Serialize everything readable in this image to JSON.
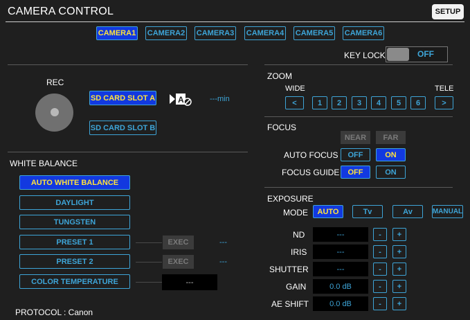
{
  "header": {
    "title": "CAMERA CONTROL",
    "setup_label": "SETUP"
  },
  "cameras": [
    "CAMERA1",
    "CAMERA2",
    "CAMERA3",
    "CAMERA4",
    "CAMERA5",
    "CAMERA6"
  ],
  "key_lock": {
    "label": "KEY LOCK",
    "state": "OFF"
  },
  "rec": {
    "label": "REC",
    "slot_a": "SD CARD SLOT A",
    "slot_b": "SD CARD SLOT B",
    "remaining": "---min"
  },
  "white_balance": {
    "title": "WHITE BALANCE",
    "auto": "AUTO WHITE BALANCE",
    "daylight": "DAYLIGHT",
    "tungsten": "TUNGSTEN",
    "preset1": "PRESET 1",
    "preset2": "PRESET 2",
    "color_temp": "COLOR TEMPERATURE",
    "exec": "EXEC",
    "preset1_value": "---",
    "preset2_value": "---",
    "color_temp_value": "---"
  },
  "protocol": "PROTOCOL : Canon",
  "zoom": {
    "title": "ZOOM",
    "wide": "WIDE",
    "tele": "TELE",
    "left": "<",
    "right": ">",
    "steps": [
      "1",
      "2",
      "3",
      "4",
      "5",
      "6"
    ]
  },
  "focus": {
    "title": "FOCUS",
    "near": "NEAR",
    "far": "FAR",
    "auto_focus_label": "AUTO FOCUS",
    "focus_guide_label": "FOCUS GUIDE",
    "off": "OFF",
    "on": "ON"
  },
  "exposure": {
    "title": "EXPOSURE",
    "mode_label": "MODE",
    "modes": [
      "AUTO",
      "Tv",
      "Av",
      "MANUAL"
    ],
    "nd_label": "ND",
    "iris_label": "IRIS",
    "shutter_label": "SHUTTER",
    "gain_label": "GAIN",
    "ae_shift_label": "AE SHIFT",
    "nd_value": "---",
    "iris_value": "---",
    "shutter_value": "---",
    "gain_value": "0.0 dB",
    "ae_shift_value": "0.0 dB",
    "minus": "-",
    "plus": "+"
  },
  "colors": {
    "accent": "#3ea5d8",
    "selected_bg": "#1239e0",
    "selected_text": "#ffe23c",
    "background": "#1f1f1f"
  }
}
